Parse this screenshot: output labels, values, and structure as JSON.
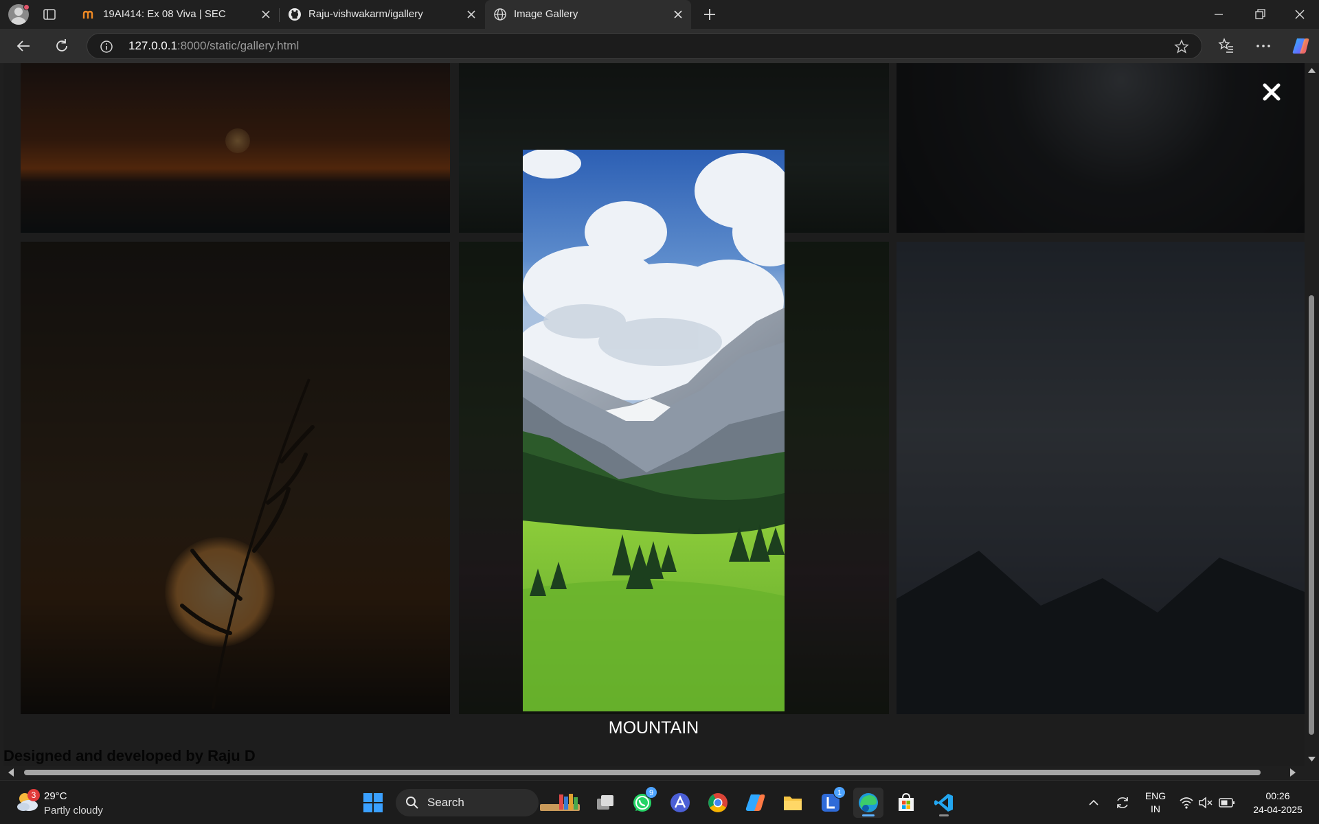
{
  "browser": {
    "tabs": [
      {
        "title": "19AI414: Ex 08 Viva | SEC",
        "active": false
      },
      {
        "title": "Raju-vishwakarm/igallery",
        "active": false
      },
      {
        "title": "Image Gallery",
        "active": true
      }
    ],
    "address": {
      "host": "127.0.0.1",
      "rest": ":8000/static/gallery.html"
    }
  },
  "page": {
    "lightbox_caption": "MOUNTAIN",
    "footer_credit": "Designed and developed by Raju D"
  },
  "taskbar": {
    "weather": {
      "temp": "29°C",
      "condition": "Partly cloudy",
      "badge": "3"
    },
    "search_label": "Search",
    "whatsapp_badge": "9",
    "lens_badge": "1",
    "language": {
      "line1": "ENG",
      "line2": "IN"
    },
    "clock": {
      "time": "00:26",
      "date": "24-04-2025"
    }
  },
  "colors": {
    "accent": "#5fb2ff",
    "chrome_dark": "#202020",
    "toolbar": "#2e2e2e"
  }
}
